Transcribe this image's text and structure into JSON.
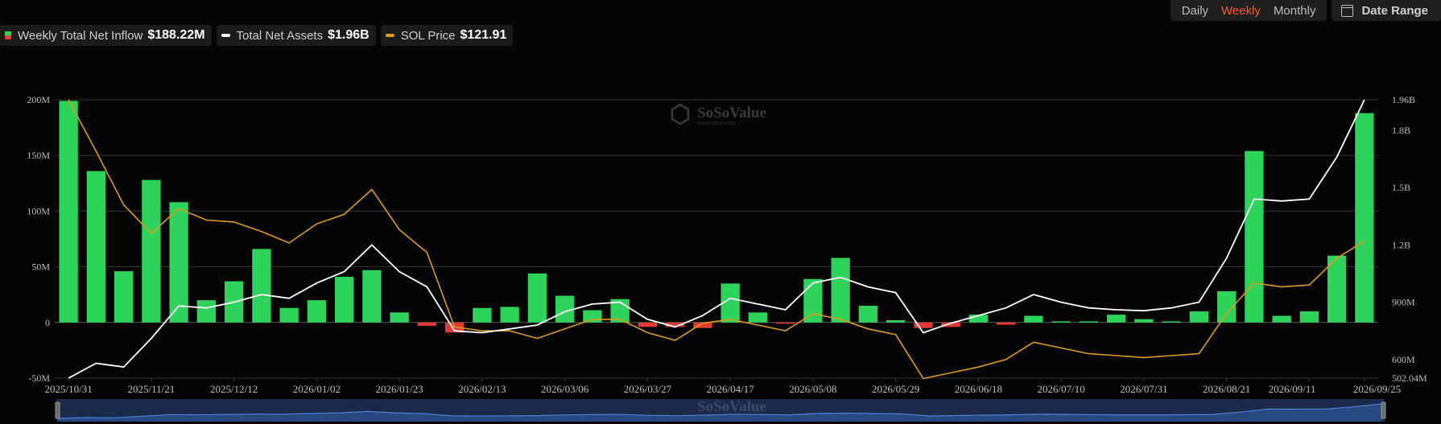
{
  "legend": {
    "inflow_label": "Weekly Total Net Inflow",
    "inflow_value": "$188.22M",
    "assets_label": "Total Net Assets",
    "assets_value": "$1.96B",
    "price_label": "SOL Price",
    "price_value": "$121.91"
  },
  "range_tabs": {
    "daily": "Daily",
    "weekly": "Weekly",
    "monthly": "Monthly",
    "date_range": "Date Range",
    "active": "Weekly"
  },
  "watermark": {
    "brand": "SoSoValue",
    "sub": "sosovalue.com"
  },
  "colors": {
    "inflow_positive": "#2ed35b",
    "inflow_negative": "#e53935",
    "assets_line": "#ffffff",
    "price_line": "#e09a1e",
    "accent": "#ff5a2c"
  },
  "chart_data": {
    "type": "bar",
    "x_tick_labels": [
      "2025/10/31",
      "2025/11/21",
      "2025/12/12",
      "2026/01/02",
      "2026/01/23",
      "2026/02/13",
      "2026/03/06",
      "2026/03/27",
      "2026/04/17",
      "2026/05/08",
      "2026/05/29",
      "2026/06/18",
      "2026/07/10",
      "2026/07/31",
      "2026/08/21",
      "2026/09/11",
      "2026/09/25"
    ],
    "y_left": {
      "ticks": [
        -50,
        0,
        50,
        100,
        150,
        200
      ],
      "tick_labels": [
        "-50M",
        "0",
        "50M",
        "100M",
        "150M",
        "200M"
      ],
      "range": [
        -50,
        200
      ],
      "unit": "M USD"
    },
    "y_right": {
      "ticks": [
        502.04,
        600,
        900,
        1200,
        1500,
        1800,
        1960
      ],
      "tick_labels": [
        "502.04M",
        "600M",
        "900M",
        "1.2B",
        "1.5B",
        "1.8B",
        "1.96B"
      ],
      "range": [
        502.04,
        1960
      ],
      "unit": "M USD"
    },
    "grid": true,
    "series": [
      {
        "name": "Weekly Total Net Inflow",
        "type": "bar",
        "axis": "left",
        "values": [
          199,
          136,
          46,
          128,
          108,
          20,
          37,
          66,
          13,
          20,
          41,
          47,
          9,
          -3,
          -9,
          13,
          14,
          44,
          24,
          11,
          21,
          -4,
          -4,
          -5,
          35,
          9,
          -1,
          39,
          58,
          15,
          2,
          -5,
          -4,
          7,
          -2,
          6,
          1,
          1,
          7,
          3,
          1,
          10,
          28,
          154,
          6,
          10,
          60,
          188
        ]
      },
      {
        "name": "Total Net Assets",
        "type": "line",
        "axis": "right",
        "values": [
          502,
          580,
          560,
          710,
          880,
          870,
          900,
          940,
          920,
          1000,
          1060,
          1200,
          1060,
          980,
          750,
          740,
          760,
          780,
          850,
          890,
          900,
          810,
          770,
          830,
          920,
          890,
          860,
          1000,
          1030,
          980,
          950,
          740,
          790,
          830,
          870,
          940,
          900,
          870,
          860,
          855,
          870,
          900,
          1130,
          1440,
          1430,
          1440,
          1660,
          1960
        ]
      },
      {
        "name": "SOL Price",
        "type": "line",
        "axis": "right",
        "values": [
          1960,
          1690,
          1410,
          1260,
          1390,
          1330,
          1320,
          1270,
          1210,
          1310,
          1360,
          1490,
          1280,
          1160,
          770,
          750,
          750,
          710,
          760,
          810,
          810,
          740,
          700,
          790,
          810,
          780,
          750,
          840,
          810,
          760,
          730,
          500,
          530,
          560,
          600,
          690,
          660,
          630,
          620,
          610,
          620,
          630,
          840,
          1000,
          980,
          990,
          1130,
          1220
        ]
      }
    ]
  }
}
